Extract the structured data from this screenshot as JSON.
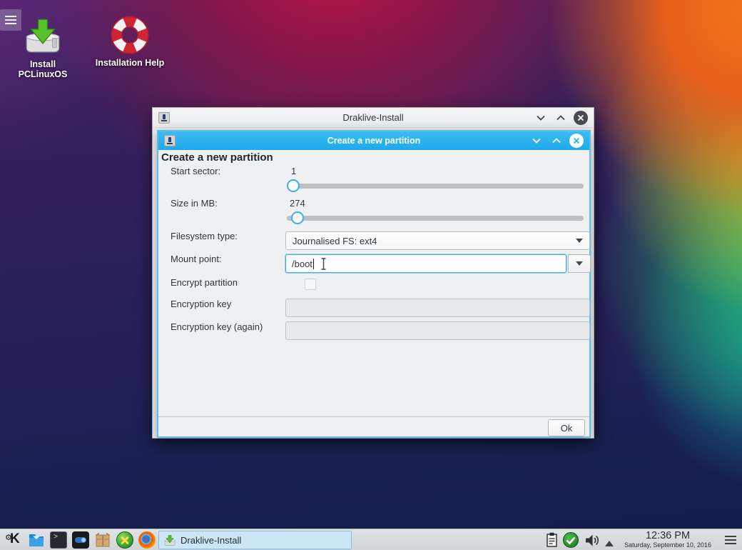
{
  "desktop": {
    "icons": [
      {
        "name": "install-pclinuxos",
        "label": "Install PCLinuxOS"
      },
      {
        "name": "installation-help",
        "label": "Installation Help"
      }
    ]
  },
  "outer_window": {
    "title": "Draklive-Install"
  },
  "dialog": {
    "title": "Create a new partition",
    "heading": "Create a new partition",
    "rows": {
      "start_sector": {
        "label": "Start sector:",
        "value": "1"
      },
      "size_mb": {
        "label": "Size in MB:",
        "value": "274"
      },
      "filesystem": {
        "label": "Filesystem type:",
        "value": "Journalised FS: ext4"
      },
      "mount_point": {
        "label": "Mount point:",
        "value": "/boot"
      },
      "encrypt": {
        "label": "Encrypt partition"
      },
      "key": {
        "label": "Encryption key"
      },
      "key_again": {
        "label": "Encryption key (again)"
      }
    },
    "ok_label": "Ok"
  },
  "taskbar": {
    "launchers": [
      "kde-menu",
      "file-manager",
      "terminal",
      "system-settings",
      "package-manager",
      "control-center",
      "firefox"
    ],
    "task_entry": {
      "label": "Draklive-Install"
    },
    "tray_icons": [
      "clipboard",
      "updates-ok",
      "volume",
      "tray-expander"
    ],
    "clock": {
      "time": "12:36 PM",
      "date": "Saturday, September 10, 2016"
    }
  },
  "colors": {
    "accent": "#3daee9",
    "dialog_titlebar": "#29b3ee",
    "task_selection": "#cbe6f7",
    "dialog_bg": "#eff0f1"
  }
}
